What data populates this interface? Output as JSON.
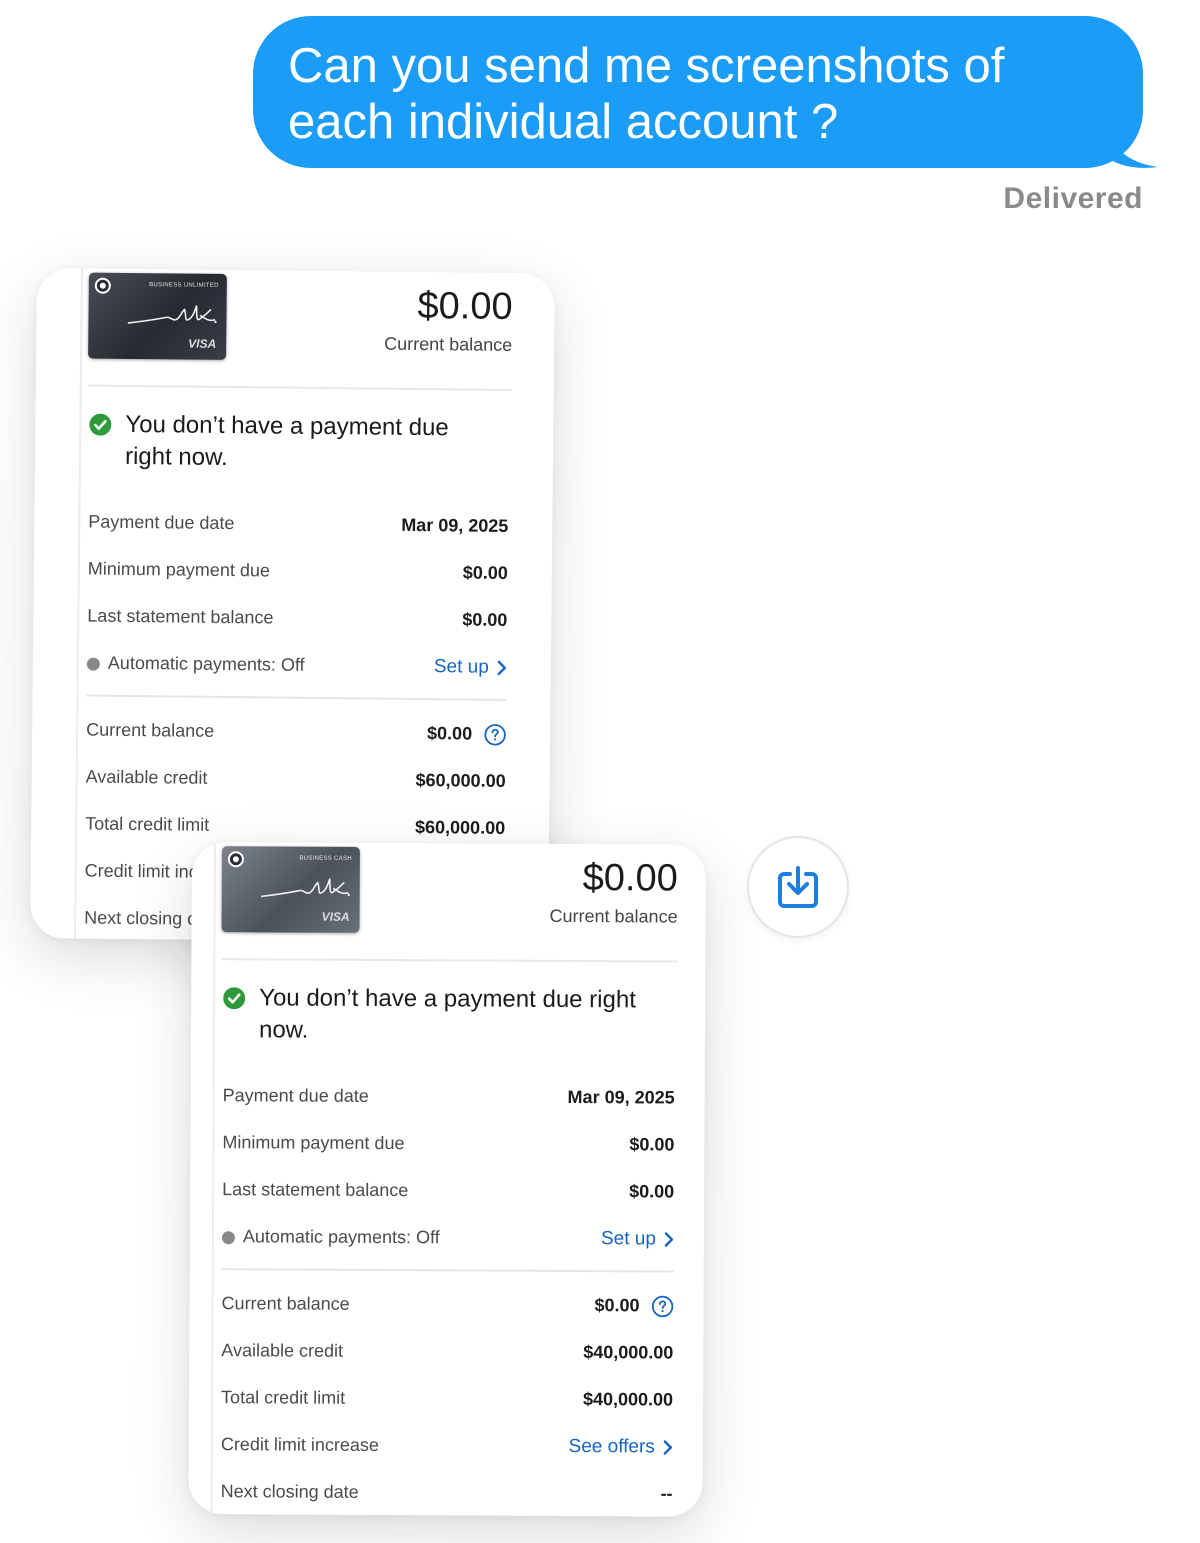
{
  "message": {
    "text": "Can you send me screenshots of each individual account ?",
    "status": "Delivered",
    "bubble_color": "#1a9cf7"
  },
  "accounts": [
    {
      "card_name": "BUSINESS UNLIMITED",
      "card_brand": "VISA",
      "current_balance": "$0.00",
      "current_balance_label": "Current balance",
      "status_message": "You don’t have a payment due right now.",
      "payment_due_date_label": "Payment due date",
      "payment_due_date": "Mar 09, 2025",
      "minimum_payment_label": "Minimum payment due",
      "minimum_payment": "$0.00",
      "last_statement_label": "Last statement balance",
      "last_statement": "$0.00",
      "autopay_label": "Automatic payments: Off",
      "autopay_action": "Set up",
      "current_balance_row_label": "Current balance",
      "current_balance_row": "$0.00",
      "available_credit_label": "Available credit",
      "available_credit": "$60,000.00",
      "total_credit_limit_label": "Total credit limit",
      "total_credit_limit": "$60,000.00",
      "credit_limit_increase_label": "Credit limit inc",
      "next_closing_label": "Next closing c"
    },
    {
      "card_name": "BUSINESS CASH",
      "card_brand": "VISA",
      "current_balance": "$0.00",
      "current_balance_label": "Current balance",
      "status_message": "You don’t have a payment due right now.",
      "payment_due_date_label": "Payment due date",
      "payment_due_date": "Mar 09, 2025",
      "minimum_payment_label": "Minimum payment due",
      "minimum_payment": "$0.00",
      "last_statement_label": "Last statement balance",
      "last_statement": "$0.00",
      "autopay_label": "Automatic payments: Off",
      "autopay_action": "Set up",
      "current_balance_row_label": "Current balance",
      "current_balance_row": "$0.00",
      "available_credit_label": "Available credit",
      "available_credit": "$40,000.00",
      "total_credit_limit_label": "Total credit limit",
      "total_credit_limit": "$40,000.00",
      "credit_limit_increase_label": "Credit limit increase",
      "credit_limit_increase_action": "See offers",
      "next_closing_label": "Next closing date",
      "next_closing": "--"
    }
  ],
  "icons": {
    "status_check": "check-circle-icon",
    "help": "question-circle-icon",
    "chevron": "chevron-right-icon",
    "save": "save-to-photos-icon"
  },
  "colors": {
    "link": "#1565c0",
    "check": "#2e9a3b"
  }
}
